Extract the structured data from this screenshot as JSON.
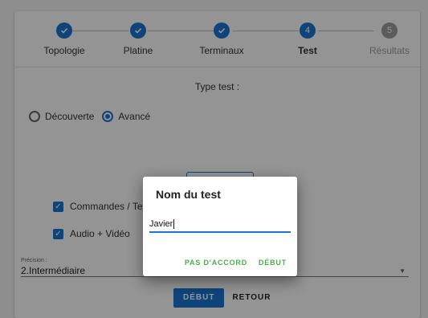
{
  "stepper": {
    "steps": [
      {
        "label": "Topologie",
        "status": "done",
        "icon": "check-icon"
      },
      {
        "label": "Platine",
        "status": "done",
        "icon": "check-icon"
      },
      {
        "label": "Terminaux",
        "status": "done",
        "icon": "check-icon"
      },
      {
        "label": "Test",
        "status": "active",
        "number": "4"
      },
      {
        "label": "Résultats",
        "status": "pending",
        "number": "5"
      }
    ]
  },
  "type_test": {
    "label": "Type test :",
    "options": [
      {
        "label": "Découverte",
        "selected": false
      },
      {
        "label": "Avancé",
        "selected": true
      }
    ]
  },
  "checkboxes": [
    {
      "label": "Commandes / Test",
      "checked": true
    },
    {
      "label": "Audio + Vidéo",
      "checked": true
    }
  ],
  "precision": {
    "label": "Précision :",
    "value": "2.Intermédiaire"
  },
  "actions": {
    "start_label": "DÉBUT",
    "back_label": "RETOUR"
  },
  "dialog": {
    "title": "Nom du test",
    "input_value": "Javier",
    "cancel_label": "PAS D'ACCORD",
    "confirm_label": "DÉBUT"
  },
  "colors": {
    "primary": "#1976d2",
    "dialog_action": "#4caf50",
    "pending": "#9e9e9e"
  }
}
